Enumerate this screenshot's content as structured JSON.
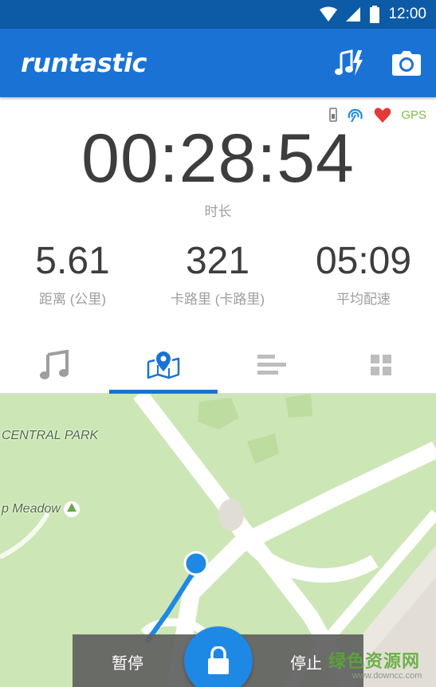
{
  "status_bar": {
    "time": "12:00",
    "icons": [
      "wifi-icon",
      "signal-icon",
      "battery-icon"
    ]
  },
  "app_bar": {
    "logo": "runtastic",
    "actions": [
      "music-boost-icon",
      "camera-icon"
    ]
  },
  "sensors": {
    "icons": [
      "phone-sensor-icon",
      "speed-sensor-icon",
      "heart-icon"
    ],
    "gps_label": "GPS"
  },
  "session": {
    "duration_value": "00:28:54",
    "duration_label": "时长",
    "stats": [
      {
        "value": "5.61",
        "label": "距离 (公里)"
      },
      {
        "value": "321",
        "label": "卡路里 (卡路里)"
      },
      {
        "value": "05:09",
        "label": "平均配速"
      }
    ]
  },
  "tabs": [
    {
      "icon": "music-note-icon",
      "selected": false
    },
    {
      "icon": "map-icon",
      "selected": true
    },
    {
      "icon": "splits-icon",
      "selected": false
    },
    {
      "icon": "dashboard-icon",
      "selected": false
    }
  ],
  "map": {
    "labels": [
      "CENTRAL PARK",
      "p Meadow"
    ]
  },
  "controls": {
    "pause_label": "暂停",
    "stop_label": "停止",
    "lock_icon": "lock-icon"
  },
  "watermark": {
    "main": "绿色资源网",
    "sub": "www.downcc.com"
  },
  "colors": {
    "status_bar": "#0d5aa7",
    "app_bar": "#1a73d4",
    "accent": "#1a73d4",
    "gps": "#7bc142",
    "heart": "#e53935",
    "map_park": "#cde6b5"
  }
}
